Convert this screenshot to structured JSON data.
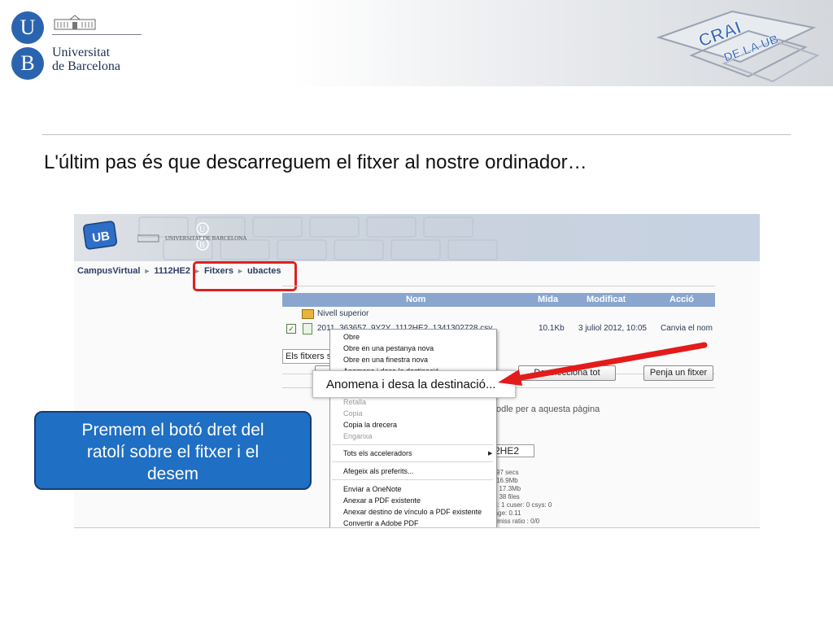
{
  "header": {
    "university_initials": [
      "U",
      "B"
    ],
    "university_name": [
      "Universitat",
      "de Barcelona"
    ],
    "crai_logo_text": [
      "CRAI",
      "DE LA UB"
    ]
  },
  "slide": {
    "instruction": "L'últim pas és que descarreguem el fitxer al nostre ordinador…"
  },
  "screenshot": {
    "banner": {
      "app_badge": "UB",
      "university_initials": [
        "U",
        "B"
      ],
      "university_name": "UNIVERSITAT DE BARCELONA"
    },
    "breadcrumb": [
      "CampusVirtual",
      "1112HE2",
      "Fitxers",
      "ubactes"
    ],
    "table": {
      "headers": [
        "Nom",
        "Mida",
        "Modificat",
        "Acció"
      ],
      "rows": [
        {
          "name": "Nivell superior",
          "size": "",
          "modified": "",
          "action": ""
        },
        {
          "name": "2011_363657_9Y2Y_1112HE2_1341302728.csv",
          "size": "10.1Kb",
          "modified": "3 juliol 2012, 10:05",
          "action": "Canvia el nom"
        }
      ]
    },
    "select_value": "Els fitxers s",
    "buttons": {
      "deselect_all": "Deselecciona tot",
      "upload": "Penja un fitxer"
    },
    "background_texts": {
      "moodle_docs": "odle per a aquesta pàgina",
      "course_code": "2HE2",
      "stats": [
        "97 secs",
        "16.9Mb",
        "k: 17.3Mb",
        "ld 38 files",
        "rs: 1 cuser: 0 csys: 0",
        "rage: 0.11",
        "lt/miss ratio : 0/0"
      ]
    },
    "context_menu": {
      "items": [
        {
          "label": "Obre",
          "disabled": false
        },
        {
          "label": "Obre en una pestanya nova",
          "disabled": false
        },
        {
          "label": "Obre en una finestra nova",
          "disabled": false
        },
        {
          "label": "Anomena i desa la destinació...",
          "disabled": false
        },
        {
          "label": "Retalla",
          "disabled": true
        },
        {
          "label": "Copia",
          "disabled": true
        },
        {
          "label": "Copia la drecera",
          "disabled": false
        },
        {
          "label": "Enganxa",
          "disabled": true
        },
        {
          "label": "Tots els acceleradors",
          "disabled": false,
          "submenu": true
        },
        {
          "label": "Afegeix als preferits...",
          "disabled": false
        },
        {
          "label": "Enviar a OneNote",
          "disabled": false
        },
        {
          "label": "Anexar a PDF existente",
          "disabled": false
        },
        {
          "label": "Anexar destino de vínculo a PDF existente",
          "disabled": false
        },
        {
          "label": "Convertir a Adobe PDF",
          "disabled": false
        }
      ]
    },
    "save_as_callout": "Anomena i desa la destinació..."
  },
  "callout": {
    "text": "Premem el botó dret del ratolí sobre el fitxer  i el desem",
    "lines": [
      "Premem el botó dret del",
      "ratolí sobre el fitxer  i el",
      "desem"
    ]
  },
  "colors": {
    "ub_blue": "#2b64ae",
    "callout_blue": "#1f6fc4",
    "highlight_red": "#e02020",
    "table_header": "#8aa6cf"
  }
}
